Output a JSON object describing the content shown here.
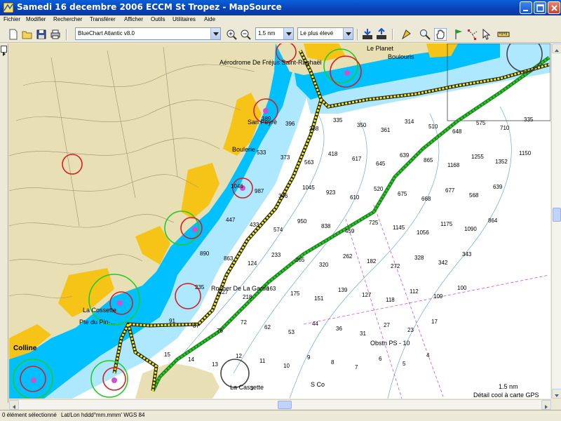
{
  "window": {
    "title": "Samedi 16 decembre 2006 ECCM St Tropez - MapSource"
  },
  "menu": [
    {
      "label": "Fichier"
    },
    {
      "label": "Modifier"
    },
    {
      "label": "Rechercher"
    },
    {
      "label": "Transférer"
    },
    {
      "label": "Afficher"
    },
    {
      "label": "Outils"
    },
    {
      "label": "Utilitaires"
    },
    {
      "label": "Aide"
    }
  ],
  "toolbar": {
    "product_combo": "BlueChart Atlantic v8.0",
    "zoom_combo": "1.5 nm",
    "detail_combo": "Le plus élevé"
  },
  "map": {
    "place_labels": {
      "aerodrome": "Aérodrome De Fréjus Saint-Raphaël",
      "le_planet": "Le Planet",
      "boulouris": "Boulouris",
      "san_peyre": "San Peyré",
      "boulerie": "Boulerie",
      "la_cossette": "La Cossette",
      "pointe": "Pte du Pin-...",
      "rocher": "Rocher De La Garde",
      "colline": "Colline",
      "la_cassette2": "La Cassette",
      "obstruction": "Obstn PS - 10",
      "s_co": "S Co"
    },
    "scale_label": "1.5 nm",
    "inset_caption": "Détail cool à carte GPS",
    "soundings": [
      "389",
      "396",
      "288",
      "335",
      "350",
      "361",
      "314",
      "510",
      "648",
      "575",
      "710",
      "335",
      "533",
      "373",
      "563",
      "418",
      "617",
      "645",
      "639",
      "865",
      "1168",
      "1255",
      "1352",
      "1150",
      "1046",
      "987",
      "346",
      "1045",
      "923",
      "610",
      "520",
      "675",
      "668",
      "677",
      "568",
      "639",
      "447",
      "433",
      "574",
      "950",
      "838",
      "459",
      "725",
      "1145",
      "1056",
      "1175",
      "1090",
      "864",
      "890",
      "863",
      "124",
      "233",
      "165",
      "320",
      "262",
      "182",
      "272",
      "328",
      "342",
      "343",
      "235",
      "227",
      "218",
      "163",
      "175",
      "151",
      "139",
      "127",
      "118",
      "112",
      "109",
      "100",
      "91",
      "87",
      "76",
      "72",
      "62",
      "53",
      "44",
      "36",
      "31",
      "27",
      "23",
      "17",
      "15",
      "14",
      "13",
      "12",
      "11",
      "10",
      "9",
      "8",
      "7",
      "6",
      "5",
      "4",
      "3"
    ]
  },
  "status": {
    "selection": "0 élément sélectionné",
    "datum": "Lat/Lon hddd°mm.mmm' WGS 84"
  },
  "colors": {
    "land": "#e8dfb4",
    "shallow": "#00c0ff",
    "mid": "#aee8ff",
    "deep": "#ffffff",
    "sand": "#f5c417",
    "route_yellow": "#f7f200",
    "route_green": "#22cc22"
  }
}
